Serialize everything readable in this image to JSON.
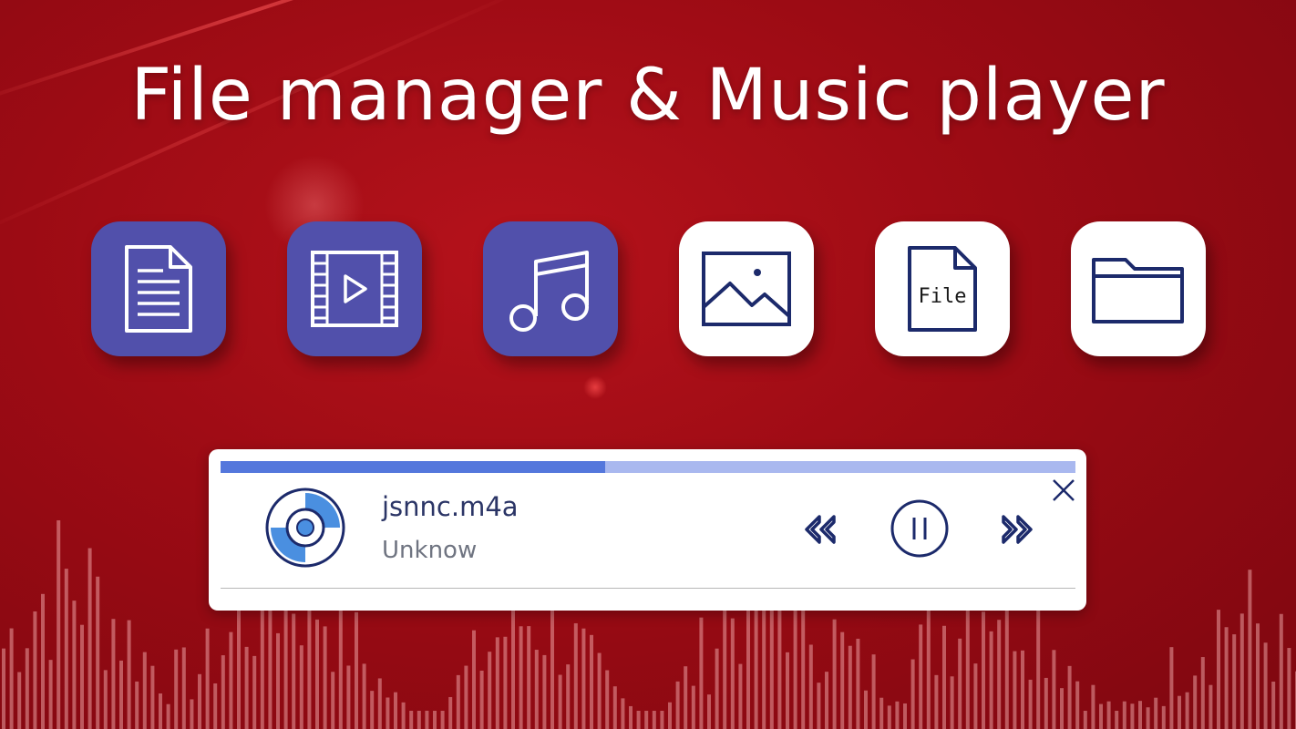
{
  "banner": {
    "title": "File manager & Music player"
  },
  "categories": [
    {
      "icon": "document-icon",
      "style": "purple"
    },
    {
      "icon": "video-icon",
      "style": "purple"
    },
    {
      "icon": "music-note-icon",
      "style": "purple"
    },
    {
      "icon": "image-icon",
      "style": "white"
    },
    {
      "icon": "file-icon",
      "label": "File",
      "style": "white"
    },
    {
      "icon": "folder-icon",
      "style": "white"
    }
  ],
  "player": {
    "track_title": "jsnnc.m4a",
    "artist": "Unknow",
    "progress": 0.45,
    "controls": {
      "prev_icon": "rewind-icon",
      "pause_icon": "pause-icon",
      "next_icon": "fast-forward-icon",
      "close_icon": "close-icon"
    }
  },
  "colors": {
    "background": "#9c0b14",
    "tile_purple": "#5150ab",
    "tile_white": "#ffffff",
    "icon_stroke": "#1c2a6b",
    "progress_fill": "#5477dc",
    "progress_track": "#a9b8ef",
    "title_text": "#ffffff"
  }
}
